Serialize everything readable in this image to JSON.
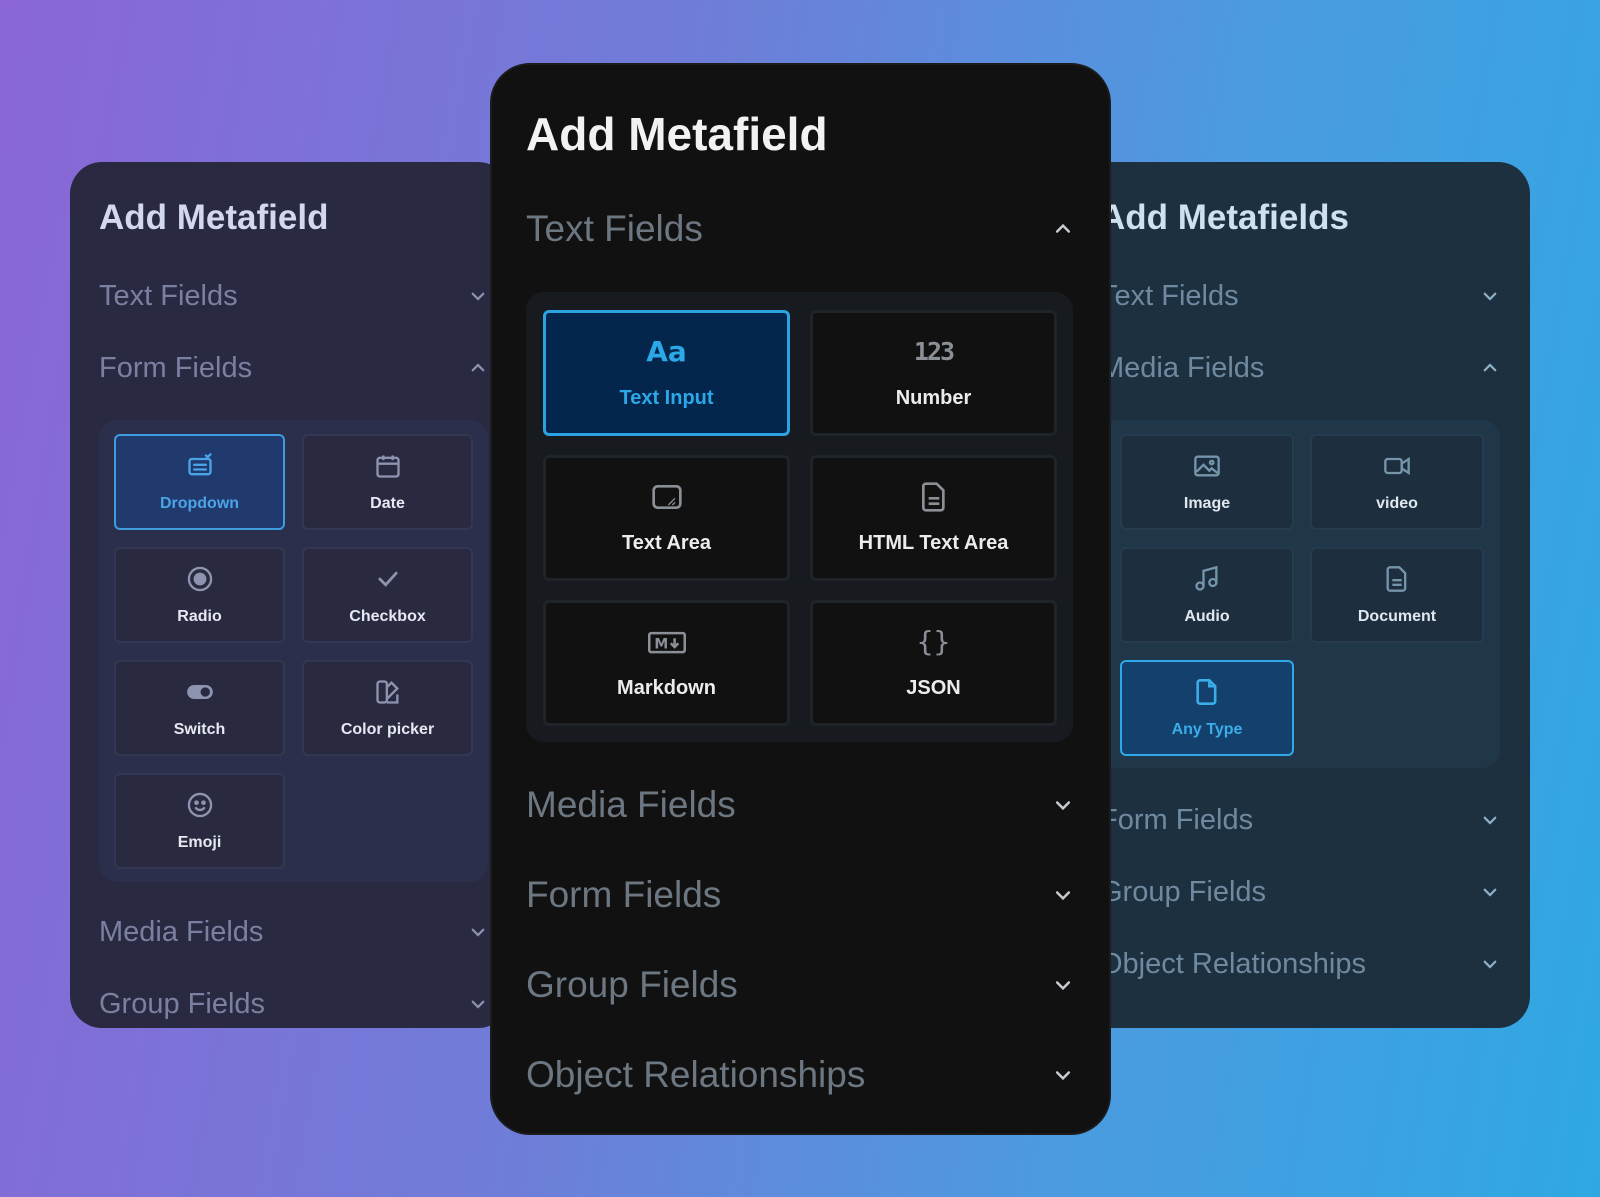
{
  "colors": {
    "accent": "#2ba8e8",
    "left_panel": "#292a42",
    "center_panel": "#111111",
    "right_panel": "#1d3040"
  },
  "left": {
    "title": "Add Metafield",
    "sections_before": [
      {
        "label": "Text Fields",
        "expanded": false
      },
      {
        "label": "Form Fields",
        "expanded": true
      }
    ],
    "tiles": [
      {
        "label": "Dropdown",
        "icon": "dropdown-icon",
        "selected": true
      },
      {
        "label": "Date",
        "icon": "calendar-icon"
      },
      {
        "label": "Radio",
        "icon": "radio-icon"
      },
      {
        "label": "Checkbox",
        "icon": "check-icon"
      },
      {
        "label": "Switch",
        "icon": "toggle-icon"
      },
      {
        "label": "Color picker",
        "icon": "color-picker-icon"
      },
      {
        "label": "Emoji",
        "icon": "emoji-icon"
      }
    ],
    "sections_after": [
      {
        "label": "Media Fields",
        "expanded": false
      },
      {
        "label": "Group Fields",
        "expanded": false
      }
    ]
  },
  "center": {
    "title": "Add Metafield",
    "sections_before": [
      {
        "label": "Text Fields",
        "expanded": true
      }
    ],
    "tiles": [
      {
        "label": "Text Input",
        "icon": "text-aa-icon",
        "selected": true
      },
      {
        "label": "Number",
        "icon": "number-123-icon"
      },
      {
        "label": "Text Area",
        "icon": "textarea-icon"
      },
      {
        "label": "HTML Text Area",
        "icon": "document-icon"
      },
      {
        "label": "Markdown",
        "icon": "markdown-icon"
      },
      {
        "label": "JSON",
        "icon": "braces-icon"
      }
    ],
    "sections_after": [
      {
        "label": "Media Fields",
        "expanded": false
      },
      {
        "label": "Form Fields",
        "expanded": false
      },
      {
        "label": "Group Fields",
        "expanded": false
      },
      {
        "label": "Object Relationships",
        "expanded": false
      }
    ]
  },
  "right": {
    "title": "Add Metafields",
    "sections_before": [
      {
        "label": "Text Fields",
        "expanded": false
      },
      {
        "label": "Media Fields",
        "expanded": true
      }
    ],
    "tiles": [
      {
        "label": "Image",
        "icon": "image-icon"
      },
      {
        "label": "video",
        "icon": "video-icon"
      },
      {
        "label": "Audio",
        "icon": "music-note-icon"
      },
      {
        "label": "Document",
        "icon": "document-icon"
      },
      {
        "label": "Any Type",
        "icon": "file-icon",
        "selected": true
      }
    ],
    "sections_after": [
      {
        "label": "Form Fields",
        "expanded": false
      },
      {
        "label": "Group Fields",
        "expanded": false
      },
      {
        "label": "Object Relationships",
        "expanded": false
      }
    ]
  }
}
